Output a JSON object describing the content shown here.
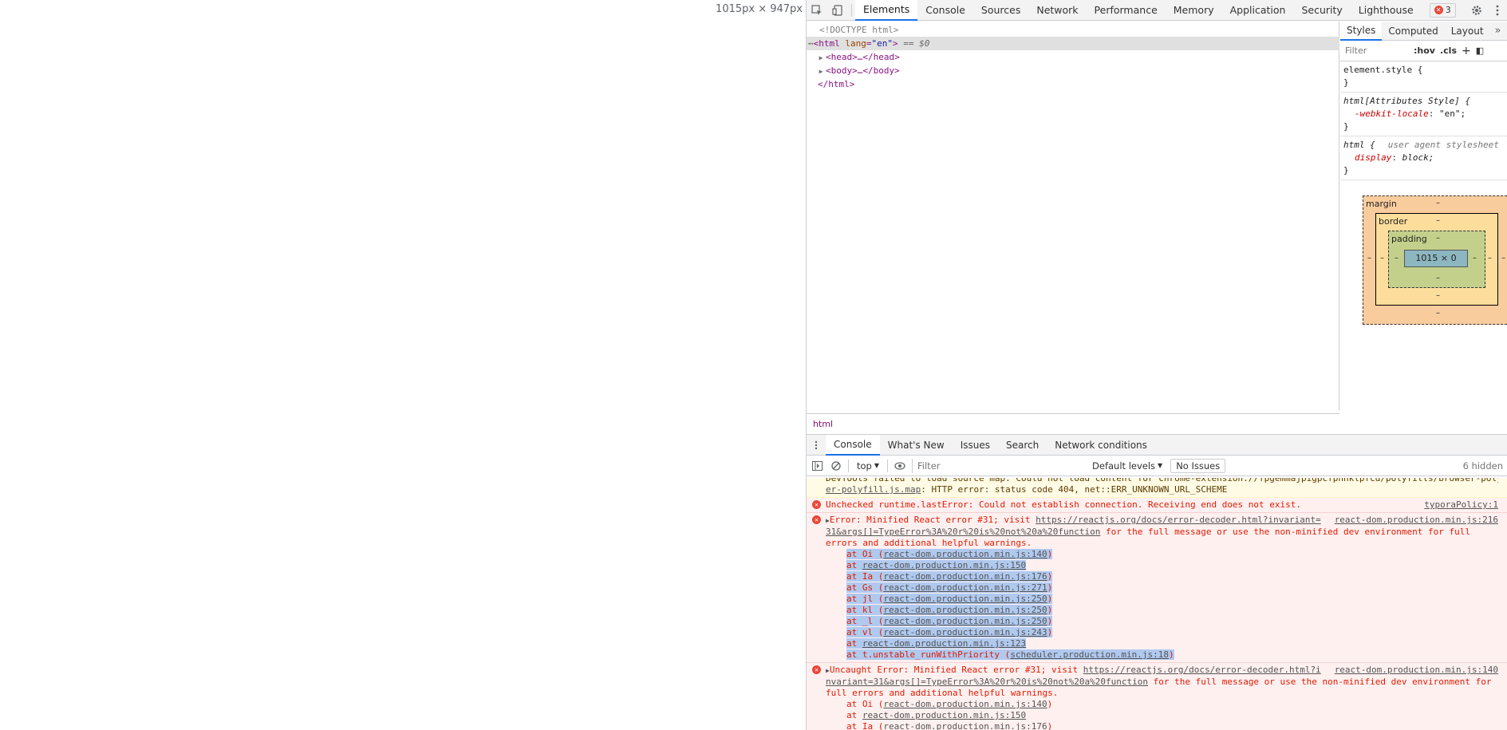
{
  "page": {
    "viewport_size": "1015px × 947px"
  },
  "toolbar": {
    "tabs": [
      "Elements",
      "Console",
      "Sources",
      "Network",
      "Performance",
      "Memory",
      "Application",
      "Security",
      "Lighthouse"
    ],
    "active_tab": "Elements",
    "error_count": "3"
  },
  "elements": {
    "doctype": "<!DOCTYPE html>",
    "html_open_tag": "html",
    "html_attr_name": "lang",
    "html_attr_val": "\"en\"",
    "eq0": "== $0",
    "head": "<head>…</head>",
    "body": "<body>…</body>",
    "html_close": "</html>",
    "breadcrumb": "html"
  },
  "styles": {
    "tabs": [
      "Styles",
      "Computed",
      "Layout"
    ],
    "filter_placeholder": "Filter",
    "hov": ":hov",
    "cls": ".cls",
    "rules": [
      {
        "selector": "element.style {",
        "close": "}"
      },
      {
        "selector": "html[Attributes Style] {",
        "prop": "-webkit-locale",
        "val": "\"en\";",
        "close": "}"
      },
      {
        "selector": "html {",
        "ua": "user agent stylesheet",
        "prop": "display",
        "val": "block;",
        "close": "}"
      }
    ]
  },
  "boxmodel": {
    "margin": "margin",
    "border": "border",
    "padding": "padding",
    "content": "1015 × 0",
    "dash": "–"
  },
  "drawer": {
    "tabs": [
      "Console",
      "What's New",
      "Issues",
      "Search",
      "Network conditions"
    ],
    "context": "top",
    "filter_placeholder": "Filter",
    "levels": "Default levels",
    "issues": "No Issues",
    "hidden": "6 hidden"
  },
  "console": {
    "warn_line1": "DevTools failed to load source map: Could not load content for chrome-extension://fpgemmajpigpcfpnhklpfcd/polyfills/browser-polyfill.js.map",
    "warn_line2_link": "er-polyfill.js.map",
    "warn_line2_text": ": HTTP error: status code 404, net::ERR_UNKNOWN_URL_SCHEME",
    "err1_text": "Unchecked runtime.lastError: Could not establish connection. Receiving end does not exist.",
    "err1_src": "typoraPolicy:1",
    "err2_prefix": "Error: Minified React error #31; visit ",
    "err2_link1": "https://reactjs.org/docs/error-decoder.html?invariant=",
    "err2_src": "react-dom.production.min.js:216",
    "err2_link2": "31&args[]=TypeError%3A%20r%20is%20not%20a%20function",
    "err2_rest": " for the full message or use the non-minified dev environment for full",
    "err2_rest2": "errors and additional helpful warnings.",
    "err2_stack": [
      {
        "fn": "at Oi (",
        "file": "react-dom.production.min.js:140",
        "end": ")"
      },
      {
        "fn": "at ",
        "file": "react-dom.production.min.js:150",
        "end": ""
      },
      {
        "fn": "at Ia (",
        "file": "react-dom.production.min.js:176",
        "end": ")"
      },
      {
        "fn": "at Gs (",
        "file": "react-dom.production.min.js:271",
        "end": ")"
      },
      {
        "fn": "at jl (",
        "file": "react-dom.production.min.js:250",
        "end": ")"
      },
      {
        "fn": "at kl (",
        "file": "react-dom.production.min.js:250",
        "end": ")"
      },
      {
        "fn": "at _l (",
        "file": "react-dom.production.min.js:250",
        "end": ")"
      },
      {
        "fn": "at vl (",
        "file": "react-dom.production.min.js:243",
        "end": ")"
      },
      {
        "fn": "at ",
        "file": "react-dom.production.min.js:123",
        "end": ""
      },
      {
        "fn": "at t.unstable_runWithPriority (",
        "file": "scheduler.production.min.js:18",
        "end": ")"
      }
    ],
    "err3_prefix": "Uncaught Error: Minified React error #31; visit ",
    "err3_link1": "https://reactjs.org/docs/error-decoder.html?i",
    "err3_src": "react-dom.production.min.js:140",
    "err3_link2": "nvariant=31&args[]=TypeError%3A%20r%20is%20not%20a%20function",
    "err3_rest": " for the full message or use the non-minified dev environment for",
    "err3_rest2": "full errors and additional helpful warnings.",
    "err3_stack": [
      {
        "fn": "at Oi (",
        "file": "react-dom.production.min.js:140",
        "end": ")"
      },
      {
        "fn": "at ",
        "file": "react-dom.production.min.js:150",
        "end": ""
      },
      {
        "fn": "at Ia (",
        "file": "react-dom.production.min.js:176",
        "end": ")"
      }
    ]
  }
}
